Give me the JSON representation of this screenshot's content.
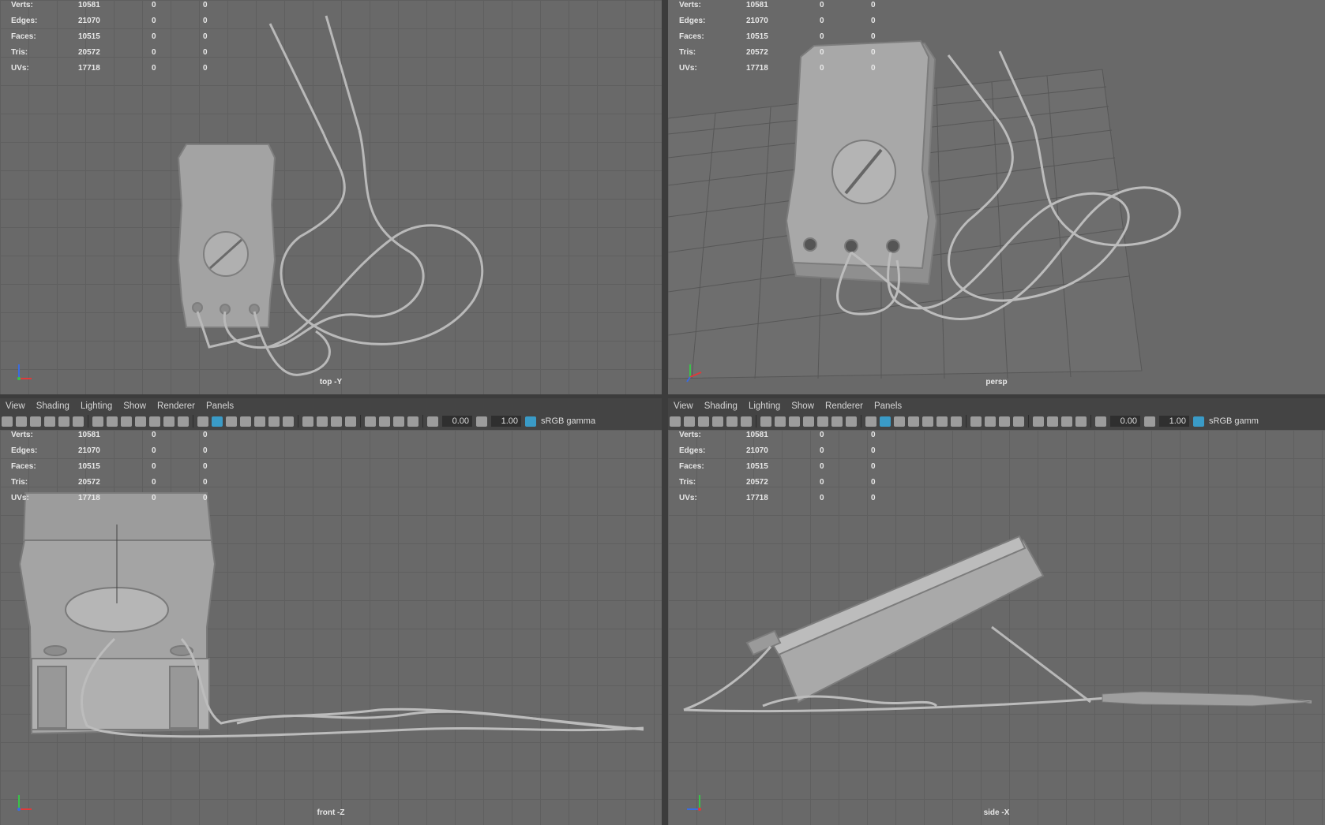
{
  "stats": {
    "labels": [
      "Verts:",
      "Edges:",
      "Faces:",
      "Tris:",
      "UVs:"
    ],
    "values": [
      "10581",
      "21070",
      "10515",
      "20572",
      "17718"
    ],
    "col2": [
      "0",
      "0",
      "0",
      "0",
      "0"
    ],
    "col3": [
      "0",
      "0",
      "0",
      "0",
      "0"
    ]
  },
  "panels": {
    "top": {
      "camera": "top -Y"
    },
    "persp": {
      "camera": "persp"
    },
    "front": {
      "camera": "front -Z"
    },
    "side": {
      "camera": "side -X"
    }
  },
  "menu": {
    "items": [
      "View",
      "Shading",
      "Lighting",
      "Show",
      "Renderer",
      "Panels"
    ]
  },
  "toolbar": {
    "field1": "0.00",
    "field2": "1.00",
    "gamma": "sRGB gamma",
    "gamma_right": "sRGB gamm"
  },
  "colors": {
    "viewport_bg": "#696969",
    "grid": "#5f5f5f",
    "ui_bg": "#444444",
    "accent": "#3a9bc7",
    "model": "#a6a6a6"
  }
}
